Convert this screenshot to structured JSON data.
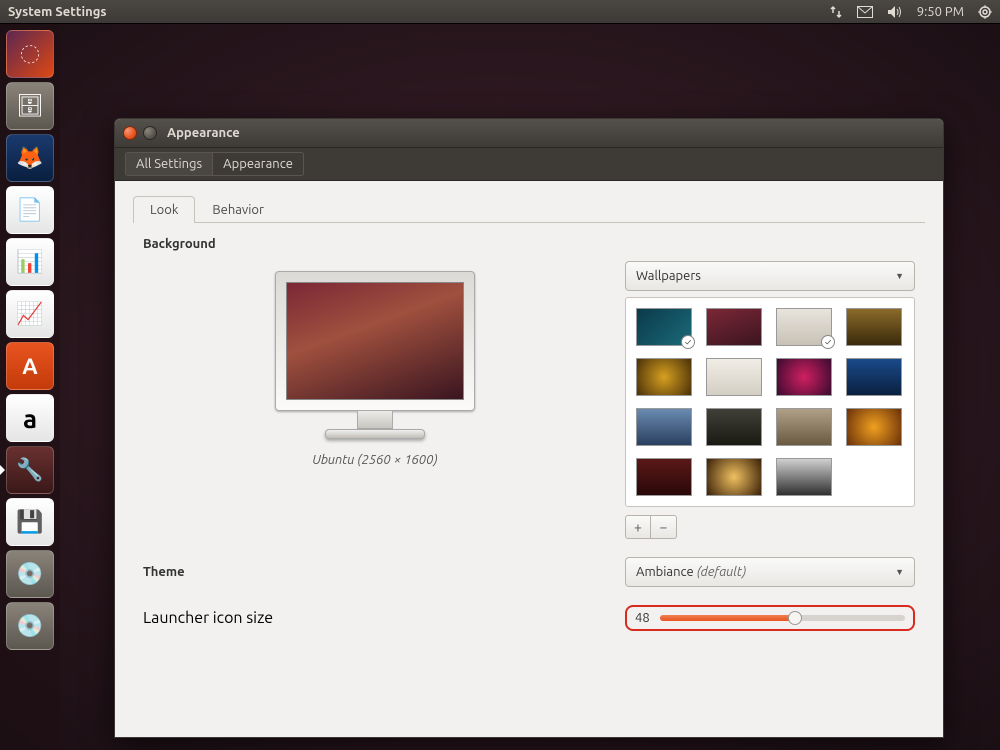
{
  "topbar": {
    "title": "System Settings",
    "time": "9:50 PM"
  },
  "launcher": {
    "items": [
      {
        "name": "dash-icon",
        "bg": "linear-gradient(135deg,#5e2750,#dd4814)",
        "glyph": "◌"
      },
      {
        "name": "files-icon",
        "bg": "linear-gradient(#89837a,#5c574f)",
        "glyph": "🗄"
      },
      {
        "name": "firefox-icon",
        "bg": "linear-gradient(#1a3a6e,#0a1f3f)",
        "glyph": "🦊"
      },
      {
        "name": "writer-icon",
        "bg": "linear-gradient(#ffffff,#e5e5e5)",
        "glyph": "📄"
      },
      {
        "name": "calc-icon",
        "bg": "linear-gradient(#ffffff,#e5e5e5)",
        "glyph": "📊"
      },
      {
        "name": "impress-icon",
        "bg": "linear-gradient(#ffffff,#e5e5e5)",
        "glyph": "📈"
      },
      {
        "name": "software-center-icon",
        "bg": "linear-gradient(#e95420,#c33b0a)",
        "glyph": "A"
      },
      {
        "name": "amazon-icon",
        "bg": "linear-gradient(#ffffff,#e5e5e5)",
        "glyph": "a"
      },
      {
        "name": "settings-icon",
        "bg": "linear-gradient(#6a3030,#3a1818)",
        "glyph": "🔧"
      },
      {
        "name": "save-icon",
        "bg": "linear-gradient(#ffffff,#e5e5e5)",
        "glyph": "💾"
      },
      {
        "name": "dvd-icon-1",
        "bg": "linear-gradient(#89837a,#5c574f)",
        "glyph": "💿"
      },
      {
        "name": "dvd-icon-2",
        "bg": "linear-gradient(#89837a,#5c574f)",
        "glyph": "💿"
      }
    ]
  },
  "window": {
    "title": "Appearance",
    "breadcrumbs": [
      "All Settings",
      "Appearance"
    ],
    "tabs": [
      "Look",
      "Behavior"
    ],
    "active_tab": 0,
    "background_label": "Background",
    "wallpaper_caption": "Ubuntu (2560 × 1600)",
    "source_label": "Wallpapers",
    "thumbs": [
      {
        "bg": "linear-gradient(135deg,#0b3a4a,#1a6a7a)",
        "checked": true
      },
      {
        "bg": "linear-gradient(160deg,#7c2736,#3a1520)",
        "checked": false
      },
      {
        "bg": "linear-gradient(#e8e4dc,#c8c2b6)",
        "checked": true
      },
      {
        "bg": "linear-gradient(#8a6a2a,#3a2a0a)",
        "checked": false
      },
      {
        "bg": "radial-gradient(circle,#d6a020,#4a3008)",
        "checked": false
      },
      {
        "bg": "linear-gradient(#f0ede6,#d4cfc4)",
        "checked": false
      },
      {
        "bg": "radial-gradient(circle,#d02060,#3a0a30)",
        "checked": false
      },
      {
        "bg": "linear-gradient(#1a4a8a,#0a2040)",
        "checked": false
      },
      {
        "bg": "linear-gradient(#6a8ab0,#2a4060)",
        "checked": false
      },
      {
        "bg": "linear-gradient(#404038,#1a1a14)",
        "checked": false
      },
      {
        "bg": "linear-gradient(#b0a088,#6a5a40)",
        "checked": false
      },
      {
        "bg": "radial-gradient(circle,#f0a020,#6a3008)",
        "checked": false
      },
      {
        "bg": "linear-gradient(#5a1818,#2a0808)",
        "checked": false
      },
      {
        "bg": "radial-gradient(circle,#f0c060,#3a2008)",
        "checked": false
      },
      {
        "bg": "linear-gradient(#d0d0d0,#303030)",
        "checked": false
      }
    ],
    "add_label": "+",
    "remove_label": "−",
    "theme_label": "Theme",
    "theme_value": "Ambiance",
    "theme_default": "(default)",
    "launcher_label": "Launcher icon size",
    "launcher_value": "48"
  }
}
